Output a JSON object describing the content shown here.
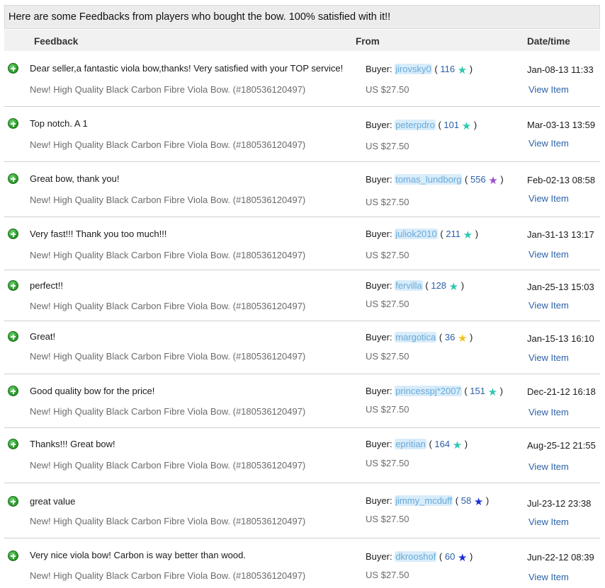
{
  "banner": {
    "text": "Here are some Feedbacks from players who bought the bow. 100% satisfied with it!!"
  },
  "columns": {
    "feedback": "Feedback",
    "from": "From",
    "datetime": "Date/time"
  },
  "row_common": {
    "item": "New! High Quality Black Carbon Fibre Viola Bow. (#180536120497)",
    "buyer_label": "Buyer:",
    "price": "US $27.50",
    "view_label": "View Item"
  },
  "colors": {
    "turquoise_star": "#2fc7b0",
    "purple_star": "#9a4fd0",
    "yellow_star": "#f2c318",
    "blue_star": "#1c2fd6",
    "link": "#2c63a8"
  },
  "feedback": [
    {
      "comment": "Dear seller,a fantastic viola bow,thanks! Very satisfied with your TOP service!",
      "buyer": "jirovsky0",
      "score": "116",
      "star": "turquoise-star-icon",
      "date": "Jan-08-13 11:33"
    },
    {
      "comment": "Top notch. A 1",
      "buyer": "peterpdro",
      "score": "101",
      "star": "turquoise-star-icon",
      "date": "Mar-03-13 13:59"
    },
    {
      "comment": "Great bow, thank you!",
      "buyer": "tomas_lundborg",
      "score": "556",
      "star": "purple-star-icon",
      "date": "Feb-02-13 08:58"
    },
    {
      "comment": "Very fast!!! Thank you too much!!!",
      "buyer": "juliok2010",
      "score": "211",
      "star": "turquoise-star-icon",
      "date": "Jan-31-13 13:17"
    },
    {
      "comment": "perfect!!",
      "buyer": "fervilla",
      "score": "128",
      "star": "turquoise-star-icon",
      "date": "Jan-25-13 15:03"
    },
    {
      "comment": "Great!",
      "buyer": "margotica",
      "score": "36",
      "star": "yellow-star-icon",
      "date": "Jan-15-13 16:10"
    },
    {
      "comment": "Good quality bow for the price!",
      "buyer": "princesspj*2007",
      "score": "151",
      "star": "turquoise-star-icon",
      "date": "Dec-21-12 16:18"
    },
    {
      "comment": "Thanks!!! Great bow!",
      "buyer": "epritian",
      "score": "164",
      "star": "turquoise-star-icon",
      "date": "Aug-25-12 21:55"
    },
    {
      "comment": "great value",
      "buyer": "jimmy_mcduff",
      "score": "58",
      "star": "blue-star-icon",
      "date": "Jul-23-12 23:38"
    },
    {
      "comment": "Very nice viola bow! Carbon is way better than wood.",
      "buyer": "dkrooshof",
      "score": "60",
      "star": "blue-star-icon",
      "date": "Jun-22-12 08:39"
    }
  ]
}
